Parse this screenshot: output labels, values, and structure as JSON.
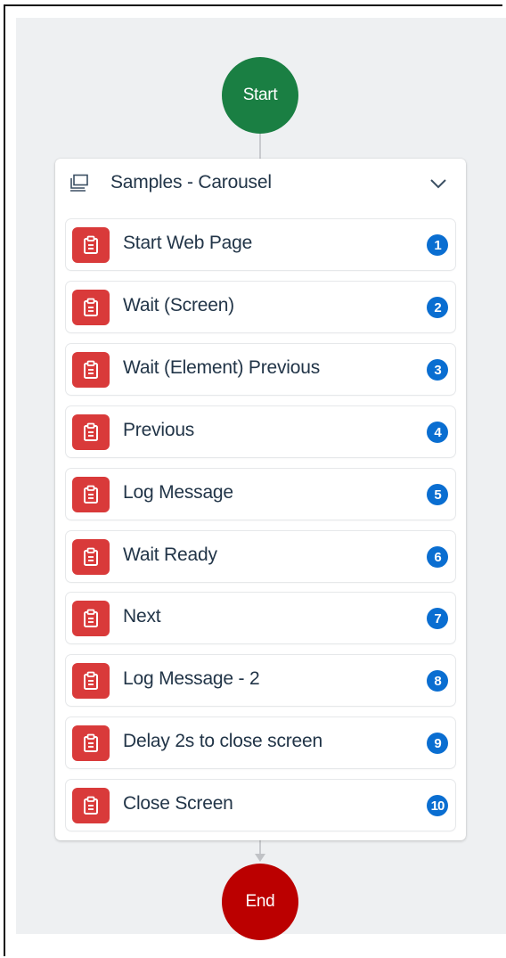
{
  "flow": {
    "start_label": "Start",
    "end_label": "End",
    "group": {
      "title": "Samples - Carousel",
      "icon": "screen-group-icon",
      "expand_icon": "chevron-down-icon",
      "steps": [
        {
          "label": "Start Web Page",
          "number": "1",
          "icon": "clipboard-icon"
        },
        {
          "label": "Wait (Screen)",
          "number": "2",
          "icon": "clipboard-icon"
        },
        {
          "label": "Wait (Element) Previous",
          "number": "3",
          "icon": "clipboard-icon"
        },
        {
          "label": "Previous",
          "number": "4",
          "icon": "clipboard-icon"
        },
        {
          "label": "Log Message",
          "number": "5",
          "icon": "clipboard-icon"
        },
        {
          "label": "Wait Ready",
          "number": "6",
          "icon": "clipboard-icon"
        },
        {
          "label": "Next",
          "number": "7",
          "icon": "clipboard-icon"
        },
        {
          "label": "Log Message - 2",
          "number": "8",
          "icon": "clipboard-icon"
        },
        {
          "label": "Delay 2s to close screen",
          "number": "9",
          "icon": "clipboard-icon"
        },
        {
          "label": "Close Screen",
          "number": "10",
          "icon": "clipboard-icon"
        }
      ]
    }
  },
  "colors": {
    "canvas": "#eef0f2",
    "start": "#1a7f43",
    "end": "#bb0000",
    "step_icon": "#d93a3a",
    "badge": "#0a6ed1",
    "text": "#223548"
  }
}
